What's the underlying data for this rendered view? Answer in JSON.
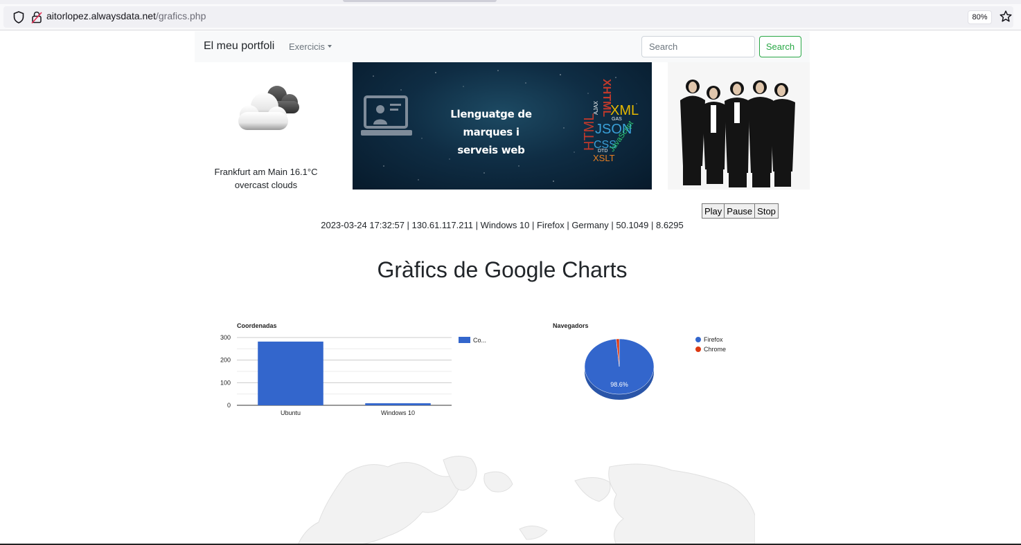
{
  "browser": {
    "url_host": "aitorlopez.alwaysdata.net",
    "url_path": "/grafics.php",
    "zoom": "80%",
    "icons": [
      "shield-icon",
      "lock-icon",
      "star-icon"
    ]
  },
  "navbar": {
    "brand": "El meu portfoli",
    "dropdown_label": "Exercicis",
    "search_placeholder": "Search",
    "search_button": "Search"
  },
  "weather": {
    "line1": "Frankfurt am Main 16.1°C",
    "line2": "overcast clouds",
    "icon": "cloud-icon"
  },
  "banner": {
    "title_line1": "Llenguatge de marques i",
    "title_line2": "serveis web",
    "word_cloud": [
      "HTML",
      "XHTML",
      "XML",
      "JSON",
      "CSS",
      "XSLT",
      "AJAX",
      "DTD",
      "GAS",
      "JavaScript"
    ]
  },
  "player": {
    "play": "Play",
    "pause": "Pause",
    "stop": "Stop"
  },
  "info_line": "2023-03-24 17:32:57 | 130.61.117.211 | Windows 10 | Firefox | Germany | 50.1049 | 8.6295",
  "page_title": "Gràfics de Google Charts",
  "colors": {
    "series_blue": "#3366cc",
    "series_red": "#dc3912",
    "search_green": "#28a745"
  },
  "chart_data": [
    {
      "type": "bar",
      "title": "Coordenadas",
      "categories": [
        "Ubuntu",
        "Windows 10"
      ],
      "series": [
        {
          "name": "Co...",
          "values": [
            282,
            9
          ]
        }
      ],
      "ylim": [
        0,
        300
      ],
      "yticks": [
        0,
        100,
        200,
        300
      ],
      "grid": true,
      "legend": "right"
    },
    {
      "type": "pie",
      "title": "Navegadors",
      "labels": [
        "Firefox",
        "Chrome"
      ],
      "values": [
        98.6,
        1.4
      ],
      "slice_label": "98.6%",
      "legend": "right"
    }
  ]
}
